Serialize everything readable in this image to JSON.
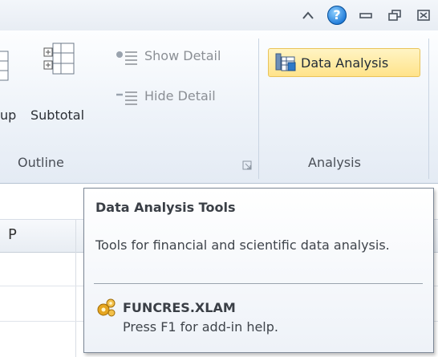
{
  "window_controls": {
    "help_glyph": "?",
    "icons": [
      "ribbon-minimize-icon",
      "help-icon",
      "minimize-icon",
      "restore-icon",
      "close-icon"
    ]
  },
  "ribbon": {
    "outline_group": {
      "label": "Outline",
      "group_button_partial": "up",
      "subtotal_label": "Subtotal",
      "show_detail_label": "Show Detail",
      "hide_detail_label": "Hide Detail"
    },
    "analysis_group": {
      "label": "Analysis",
      "data_analysis_label": "Data Analysis"
    }
  },
  "sheet": {
    "column_header": "P"
  },
  "tooltip": {
    "title": "Data Analysis Tools",
    "description": "Tools for financial and scientific data analysis.",
    "addin_name": "FUNCRES.XLAM",
    "addin_help": "Press F1 for add-in help."
  },
  "colors": {
    "highlight_bg": "#ffe38a",
    "highlight_border": "#e9c35a",
    "help_blue": "#1f7ad8"
  }
}
